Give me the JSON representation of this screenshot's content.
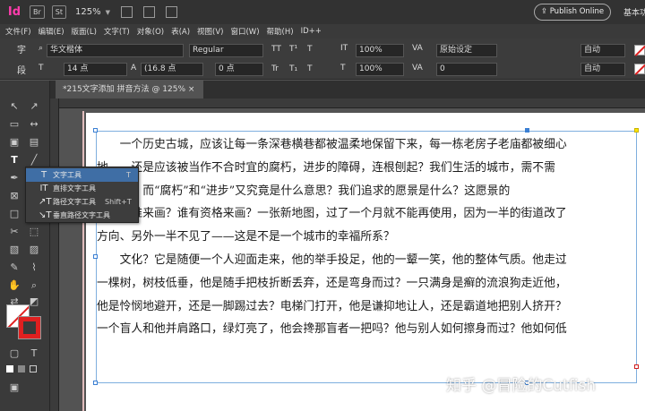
{
  "app": {
    "logo": "Id",
    "bridge_button": "Br",
    "stock_button": "St",
    "zoom": "125%",
    "publish_online": "Publish Online",
    "workspace": "基本功能"
  },
  "menu": [
    "文件(F)",
    "编辑(E)",
    "版面(L)",
    "文字(T)",
    "对象(O)",
    "表(A)",
    "视图(V)",
    "窗口(W)",
    "帮助(H)",
    "ID++"
  ],
  "control": {
    "char_label": "字",
    "para_label": "段",
    "font_family": "华文楷体",
    "font_style": "Regular",
    "font_size": "14 点",
    "leading": "(16.8 点",
    "tracking_hint": "0 点",
    "scale_v": "100%",
    "scale_h": "100%",
    "kerning": "原始设定",
    "tracking": "0",
    "auto1": "自动",
    "auto2": "自动",
    "tt_caps": "TT",
    "tt_super": "T¹",
    "tt_sub": "T₁",
    "tt_small": "Tr",
    "tt_under": "T",
    "tt_strike": "T"
  },
  "document": {
    "tab_title": "*215文字添加 拼音方法 @ 125% ×"
  },
  "flyout": {
    "items": [
      {
        "label": "文字工具",
        "shortcut": "T",
        "icon": "T"
      },
      {
        "label": "直排文字工具",
        "shortcut": "",
        "icon": "IT"
      },
      {
        "label": "路径文字工具",
        "shortcut": "Shift+T",
        "icon": "↗T"
      },
      {
        "label": "垂直路径文字工具",
        "shortcut": "",
        "icon": "↘T"
      }
    ]
  },
  "text": {
    "lines": [
      "　　一个历史古城，应该让每一条深巷横巷都被温柔地保留下来，每一栋老房子老庙都被细心",
      "地　　还是应该被当作不合时宜的腐朽，进步的障碍，连根刨起？我们生活的城市，需不需",
      "和细心？而“腐朽”和“进步”又究竟是什么意思？我们追求的愿景是什么？这愿景的",
      "蓝图由谁来画？谁有资格来画？一张新地图，过了一个月就不能再使用，因为一半的街道改了",
      "方向、另外一半不见了——这是不是一个城市的幸福所系？",
      "　　文化？它是随便一个人迎面走来，他的举手投足，他的一颦一笑，他的整体气质。他走过",
      "一棵树，树枝低垂，他是随手把枝折断丢弃，还是弯身而过？一只满身是癣的流浪狗走近他，",
      "他是怜悯地避开，还是一脚踢过去？电梯门打开，他是谦抑地让人，还是霸道地把别人挤开？",
      "一个盲人和他并肩路口，绿灯亮了，他会搀那盲者一把吗？他与别人如何擦身而过？他如何低"
    ]
  },
  "watermark": "知乎 @冒险的Cutfish"
}
